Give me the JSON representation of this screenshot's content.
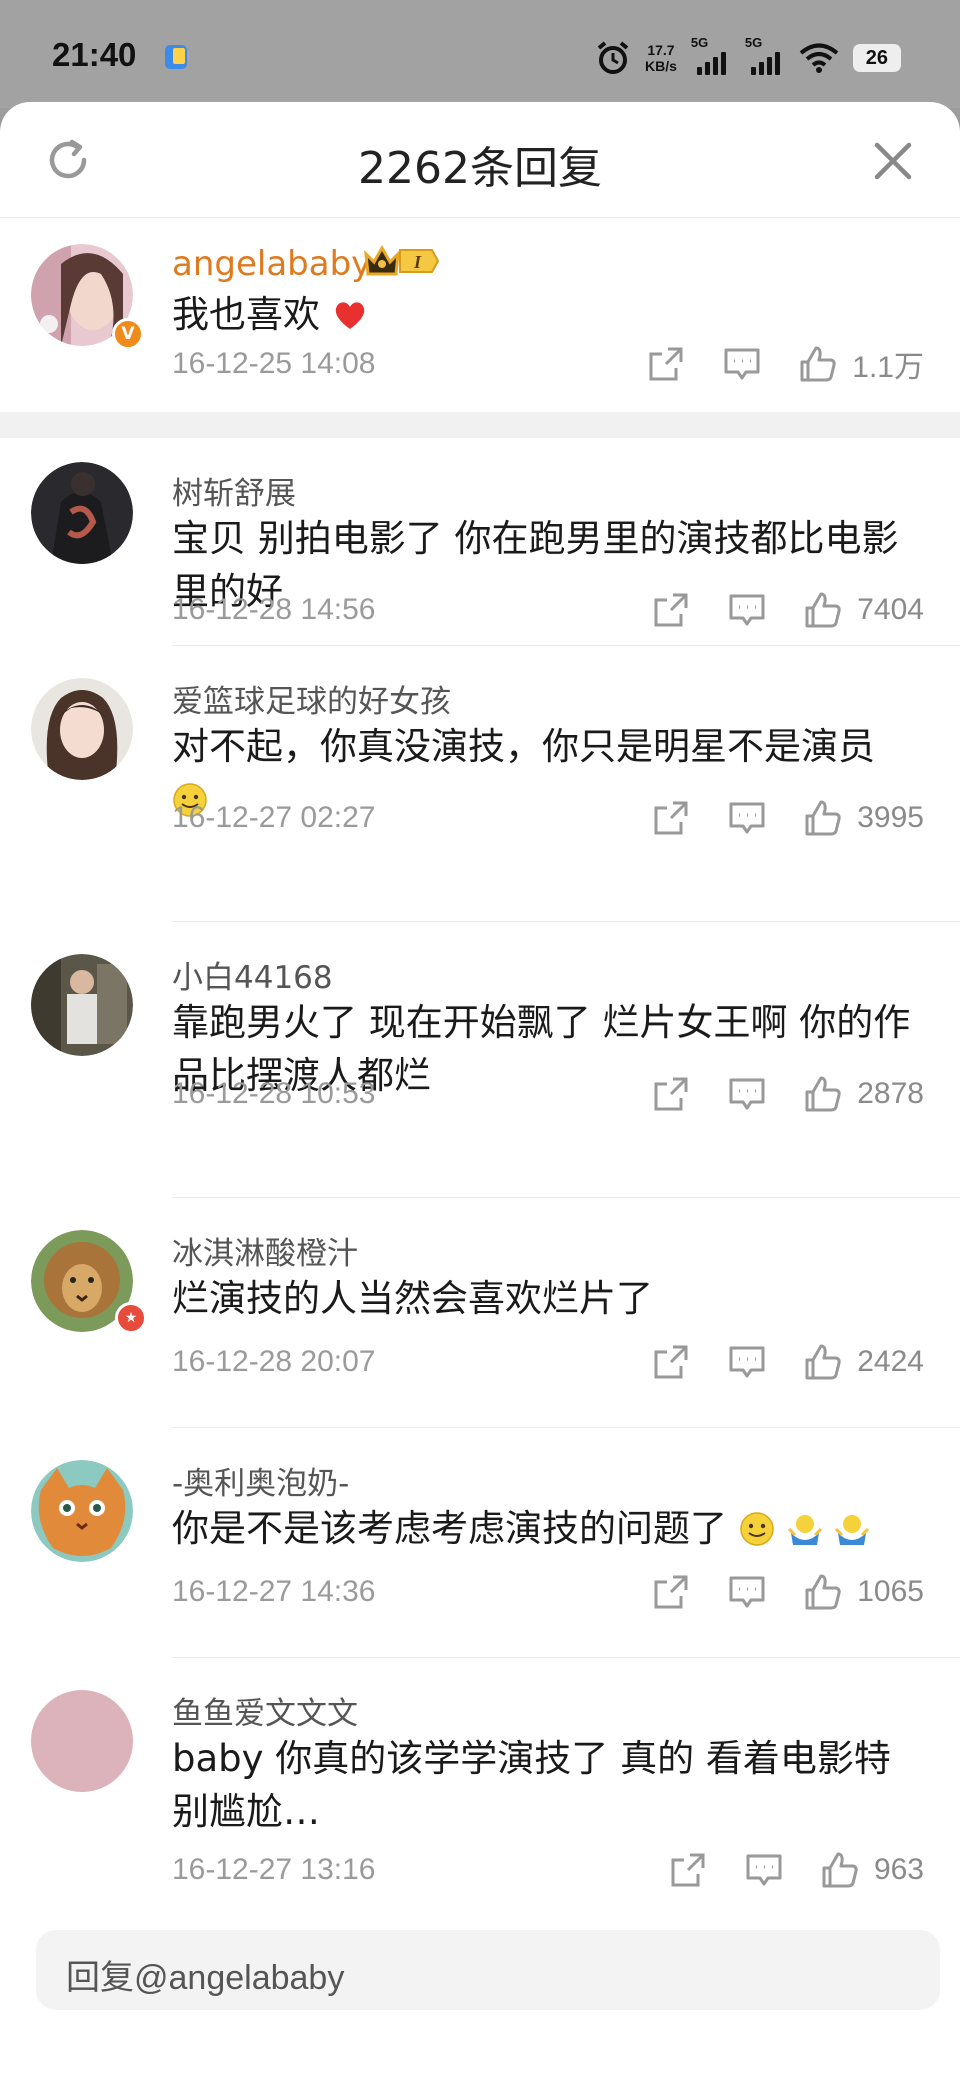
{
  "status_bar": {
    "time": "21:40",
    "net_speed": "17.7",
    "net_speed_unit": "KB/s",
    "signal_1": "5G",
    "signal_2": "5G",
    "battery": "26"
  },
  "header": {
    "title": "2262条回复"
  },
  "comments": [
    {
      "name": "angelababy",
      "text": "我也喜欢",
      "time": "16-12-25 14:08",
      "likes": "1.1万",
      "level": "I"
    },
    {
      "name": "树斩舒展",
      "text": "宝贝  别拍电影了  你在跑男里的演技都比电影里的好",
      "time": "16-12-28 14:56",
      "likes": "7404"
    },
    {
      "name": "爱篮球足球的好女孩",
      "text": "对不起，你真没演技，你只是明星不是演员",
      "time": "16-12-27 02:27",
      "likes": "3995"
    },
    {
      "name": "小白44168",
      "text": "靠跑男火了 现在开始飘了 烂片女王啊 你的作品比摆渡人都烂",
      "time": "16-12-28 10:53",
      "likes": "2878"
    },
    {
      "name": "冰淇淋酸橙汁",
      "text": "烂演技的人当然会喜欢烂片了",
      "time": "16-12-28 20:07",
      "likes": "2424"
    },
    {
      "name": "-奥利奥泡奶-",
      "text": "你是不是该考虑考虑演技的问题了",
      "time": "16-12-27 14:36",
      "likes": "1065"
    },
    {
      "name": "鱼鱼爱文文文",
      "text": "baby 你真的该学学演技了 真的 看着电影特别尴尬…",
      "time": "16-12-27 13:16",
      "likes": "963"
    }
  ],
  "reply_bar": {
    "placeholder": "回复@angelababy"
  },
  "colors": {
    "accent": "#e07a1f",
    "like_red": "#e8302f",
    "muted": "#9a9a9a"
  },
  "icons": [
    "refresh-icon",
    "close-icon",
    "share-icon",
    "comment-icon",
    "like-icon",
    "crown-icon",
    "verified-icon",
    "heart-emoji",
    "smile-emoji",
    "shrug-emoji"
  ]
}
